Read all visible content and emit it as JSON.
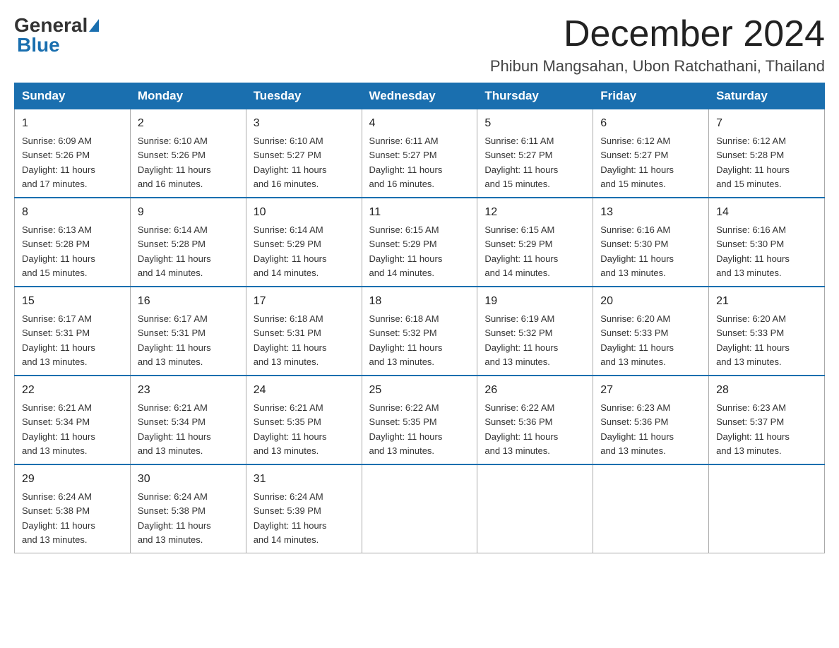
{
  "logo": {
    "general": "General",
    "blue": "Blue"
  },
  "header": {
    "title": "December 2024",
    "subtitle": "Phibun Mangsahan, Ubon Ratchathani, Thailand"
  },
  "days": [
    "Sunday",
    "Monday",
    "Tuesday",
    "Wednesday",
    "Thursday",
    "Friday",
    "Saturday"
  ],
  "weeks": [
    [
      {
        "num": "1",
        "info": "Sunrise: 6:09 AM\nSunset: 5:26 PM\nDaylight: 11 hours\nand 17 minutes."
      },
      {
        "num": "2",
        "info": "Sunrise: 6:10 AM\nSunset: 5:26 PM\nDaylight: 11 hours\nand 16 minutes."
      },
      {
        "num": "3",
        "info": "Sunrise: 6:10 AM\nSunset: 5:27 PM\nDaylight: 11 hours\nand 16 minutes."
      },
      {
        "num": "4",
        "info": "Sunrise: 6:11 AM\nSunset: 5:27 PM\nDaylight: 11 hours\nand 16 minutes."
      },
      {
        "num": "5",
        "info": "Sunrise: 6:11 AM\nSunset: 5:27 PM\nDaylight: 11 hours\nand 15 minutes."
      },
      {
        "num": "6",
        "info": "Sunrise: 6:12 AM\nSunset: 5:27 PM\nDaylight: 11 hours\nand 15 minutes."
      },
      {
        "num": "7",
        "info": "Sunrise: 6:12 AM\nSunset: 5:28 PM\nDaylight: 11 hours\nand 15 minutes."
      }
    ],
    [
      {
        "num": "8",
        "info": "Sunrise: 6:13 AM\nSunset: 5:28 PM\nDaylight: 11 hours\nand 15 minutes."
      },
      {
        "num": "9",
        "info": "Sunrise: 6:14 AM\nSunset: 5:28 PM\nDaylight: 11 hours\nand 14 minutes."
      },
      {
        "num": "10",
        "info": "Sunrise: 6:14 AM\nSunset: 5:29 PM\nDaylight: 11 hours\nand 14 minutes."
      },
      {
        "num": "11",
        "info": "Sunrise: 6:15 AM\nSunset: 5:29 PM\nDaylight: 11 hours\nand 14 minutes."
      },
      {
        "num": "12",
        "info": "Sunrise: 6:15 AM\nSunset: 5:29 PM\nDaylight: 11 hours\nand 14 minutes."
      },
      {
        "num": "13",
        "info": "Sunrise: 6:16 AM\nSunset: 5:30 PM\nDaylight: 11 hours\nand 13 minutes."
      },
      {
        "num": "14",
        "info": "Sunrise: 6:16 AM\nSunset: 5:30 PM\nDaylight: 11 hours\nand 13 minutes."
      }
    ],
    [
      {
        "num": "15",
        "info": "Sunrise: 6:17 AM\nSunset: 5:31 PM\nDaylight: 11 hours\nand 13 minutes."
      },
      {
        "num": "16",
        "info": "Sunrise: 6:17 AM\nSunset: 5:31 PM\nDaylight: 11 hours\nand 13 minutes."
      },
      {
        "num": "17",
        "info": "Sunrise: 6:18 AM\nSunset: 5:31 PM\nDaylight: 11 hours\nand 13 minutes."
      },
      {
        "num": "18",
        "info": "Sunrise: 6:18 AM\nSunset: 5:32 PM\nDaylight: 11 hours\nand 13 minutes."
      },
      {
        "num": "19",
        "info": "Sunrise: 6:19 AM\nSunset: 5:32 PM\nDaylight: 11 hours\nand 13 minutes."
      },
      {
        "num": "20",
        "info": "Sunrise: 6:20 AM\nSunset: 5:33 PM\nDaylight: 11 hours\nand 13 minutes."
      },
      {
        "num": "21",
        "info": "Sunrise: 6:20 AM\nSunset: 5:33 PM\nDaylight: 11 hours\nand 13 minutes."
      }
    ],
    [
      {
        "num": "22",
        "info": "Sunrise: 6:21 AM\nSunset: 5:34 PM\nDaylight: 11 hours\nand 13 minutes."
      },
      {
        "num": "23",
        "info": "Sunrise: 6:21 AM\nSunset: 5:34 PM\nDaylight: 11 hours\nand 13 minutes."
      },
      {
        "num": "24",
        "info": "Sunrise: 6:21 AM\nSunset: 5:35 PM\nDaylight: 11 hours\nand 13 minutes."
      },
      {
        "num": "25",
        "info": "Sunrise: 6:22 AM\nSunset: 5:35 PM\nDaylight: 11 hours\nand 13 minutes."
      },
      {
        "num": "26",
        "info": "Sunrise: 6:22 AM\nSunset: 5:36 PM\nDaylight: 11 hours\nand 13 minutes."
      },
      {
        "num": "27",
        "info": "Sunrise: 6:23 AM\nSunset: 5:36 PM\nDaylight: 11 hours\nand 13 minutes."
      },
      {
        "num": "28",
        "info": "Sunrise: 6:23 AM\nSunset: 5:37 PM\nDaylight: 11 hours\nand 13 minutes."
      }
    ],
    [
      {
        "num": "29",
        "info": "Sunrise: 6:24 AM\nSunset: 5:38 PM\nDaylight: 11 hours\nand 13 minutes."
      },
      {
        "num": "30",
        "info": "Sunrise: 6:24 AM\nSunset: 5:38 PM\nDaylight: 11 hours\nand 13 minutes."
      },
      {
        "num": "31",
        "info": "Sunrise: 6:24 AM\nSunset: 5:39 PM\nDaylight: 11 hours\nand 14 minutes."
      },
      null,
      null,
      null,
      null
    ]
  ]
}
